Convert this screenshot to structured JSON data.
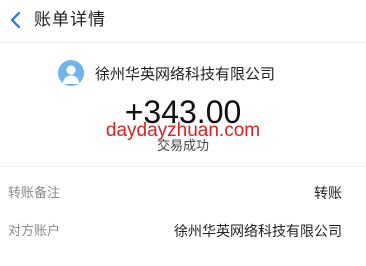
{
  "header": {
    "title": "账单详情",
    "back_icon": "chevron-left-icon",
    "accent_color": "#1677ff"
  },
  "merchant": {
    "name": "徐州华英网络科技有限公司",
    "avatar_icon": "user-avatar-icon",
    "avatar_color": "#6fb4ee"
  },
  "transaction": {
    "amount": "+343.00",
    "watermark": "daydayzhuan.com",
    "status": "交易成功"
  },
  "details": [
    {
      "label": "转账备注",
      "value": "转账"
    },
    {
      "label": "对方账户",
      "value": "徐州华英网络科技有限公司"
    }
  ]
}
